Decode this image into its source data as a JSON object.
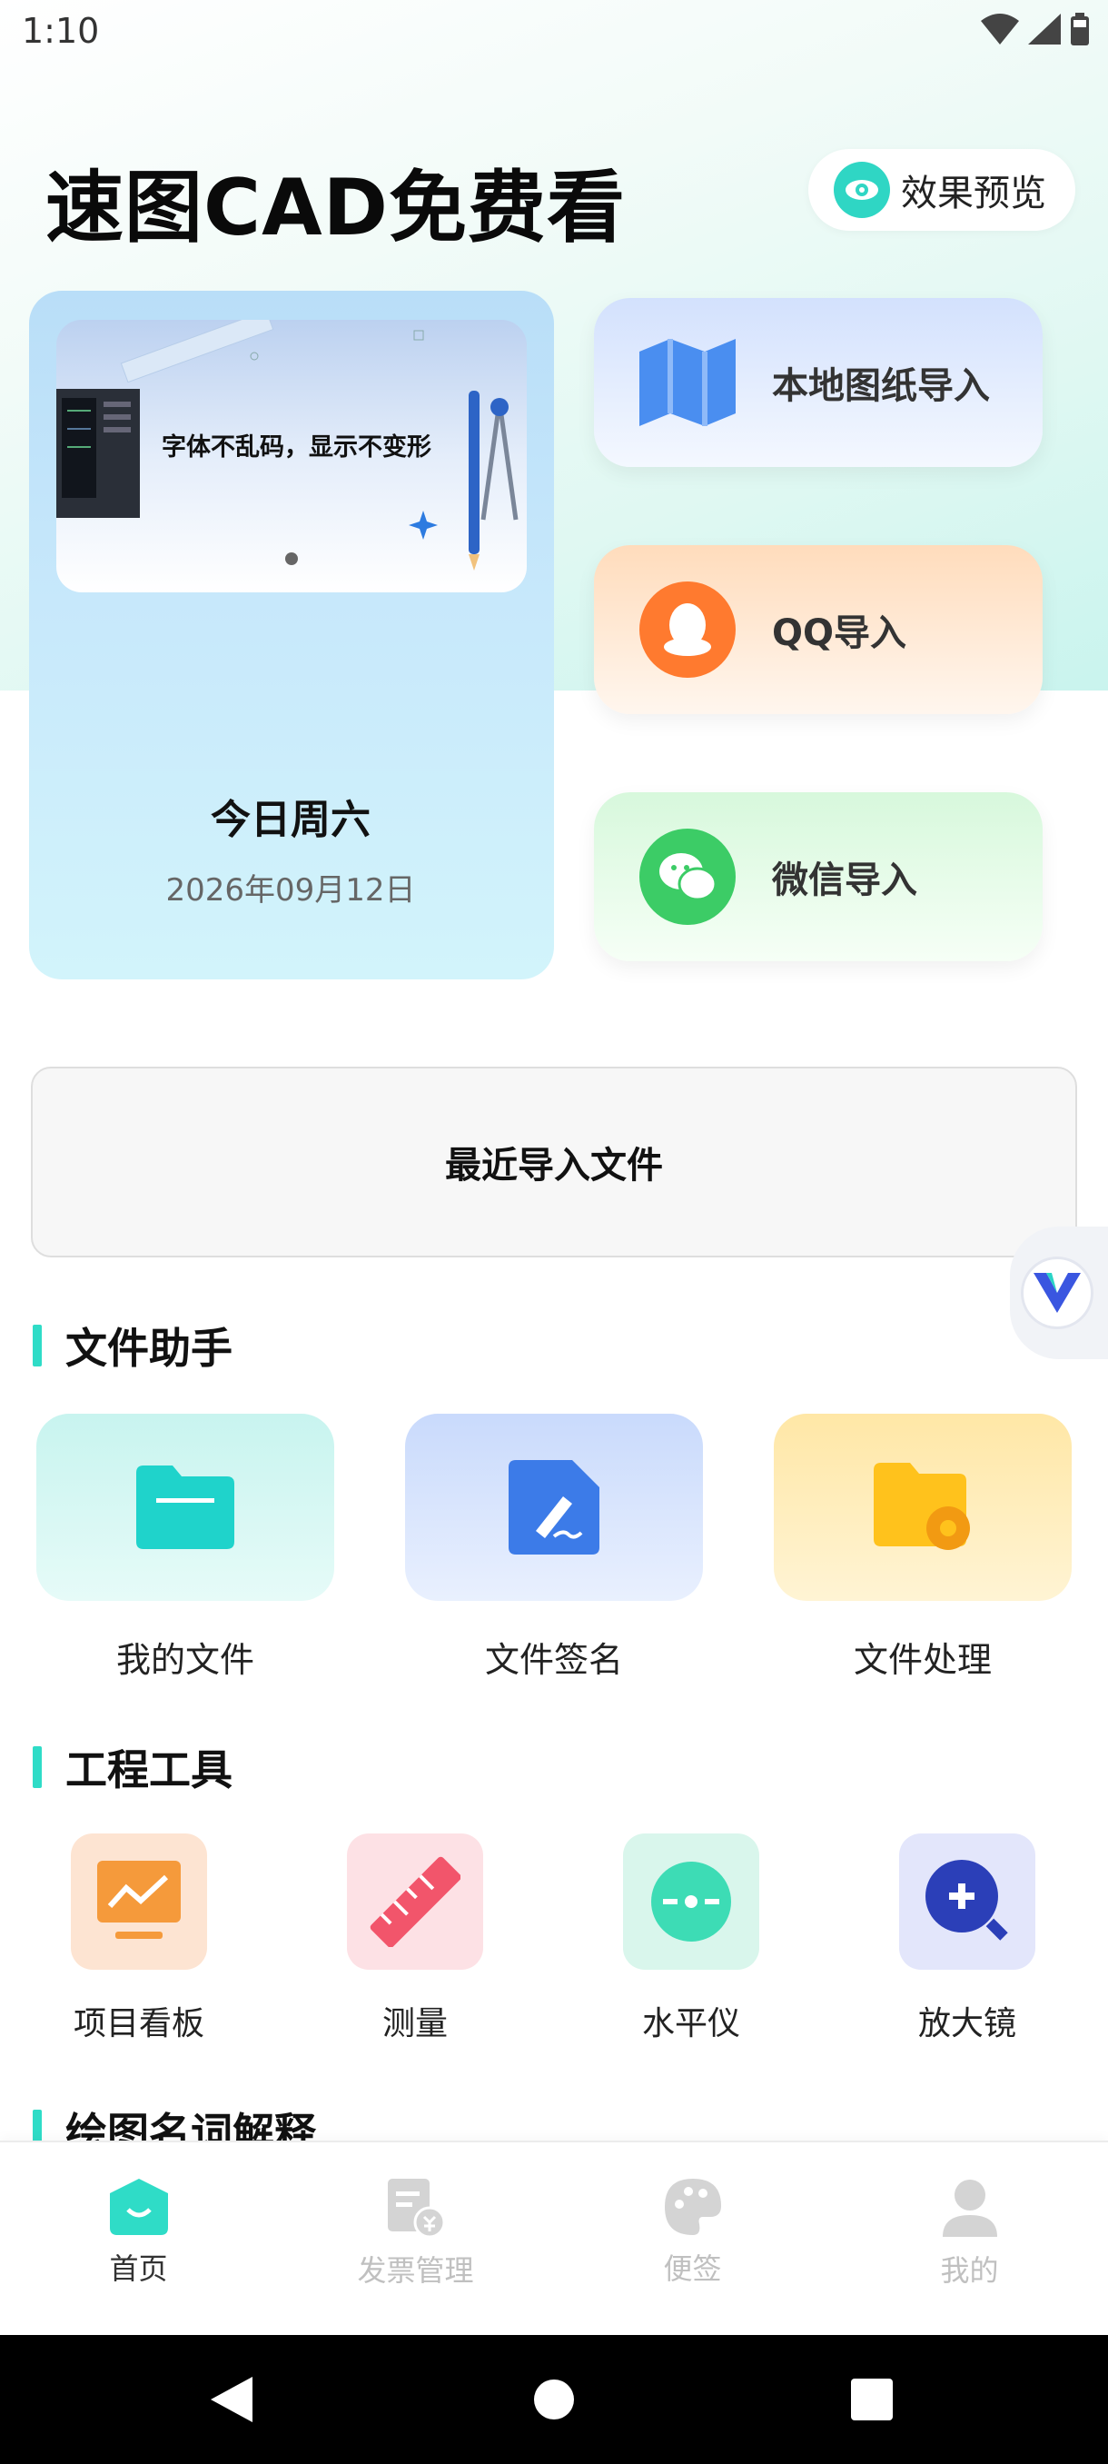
{
  "status_bar": {
    "time": "1:10"
  },
  "header": {
    "title": "速图CAD免费看",
    "preview_label": "效果预览"
  },
  "date_card": {
    "banner_text": "字体不乱码，显示不变形",
    "weekday": "今日周六",
    "date": "2026年09月12日"
  },
  "imports": {
    "local": "本地图纸导入",
    "qq": "QQ导入",
    "wechat": "微信导入"
  },
  "recent": {
    "label": "最近导入文件"
  },
  "file_helper": {
    "title": "文件助手",
    "items": [
      {
        "label": "我的文件",
        "icon": "folder-icon"
      },
      {
        "label": "文件签名",
        "icon": "signature-icon"
      },
      {
        "label": "文件处理",
        "icon": "folder-settings-icon"
      }
    ]
  },
  "engineering_tools": {
    "title": "工程工具",
    "items": [
      {
        "label": "项目看板",
        "icon": "dashboard-icon"
      },
      {
        "label": "测量",
        "icon": "ruler-icon"
      },
      {
        "label": "水平仪",
        "icon": "level-icon"
      },
      {
        "label": "放大镜",
        "icon": "magnifier-icon"
      }
    ]
  },
  "glossary": {
    "title": "绘图名词解释"
  },
  "bottom_nav": {
    "items": [
      {
        "label": "首页",
        "icon": "home-icon",
        "active": true
      },
      {
        "label": "发票管理",
        "icon": "invoice-icon",
        "active": false
      },
      {
        "label": "便签",
        "icon": "palette-icon",
        "active": false
      },
      {
        "label": "我的",
        "icon": "user-icon",
        "active": false
      }
    ]
  },
  "colors": {
    "accent": "#2fdcc7",
    "qq_orange": "#ff7a2f",
    "wechat_green": "#3ccc66",
    "map_blue": "#4a8ef0"
  }
}
